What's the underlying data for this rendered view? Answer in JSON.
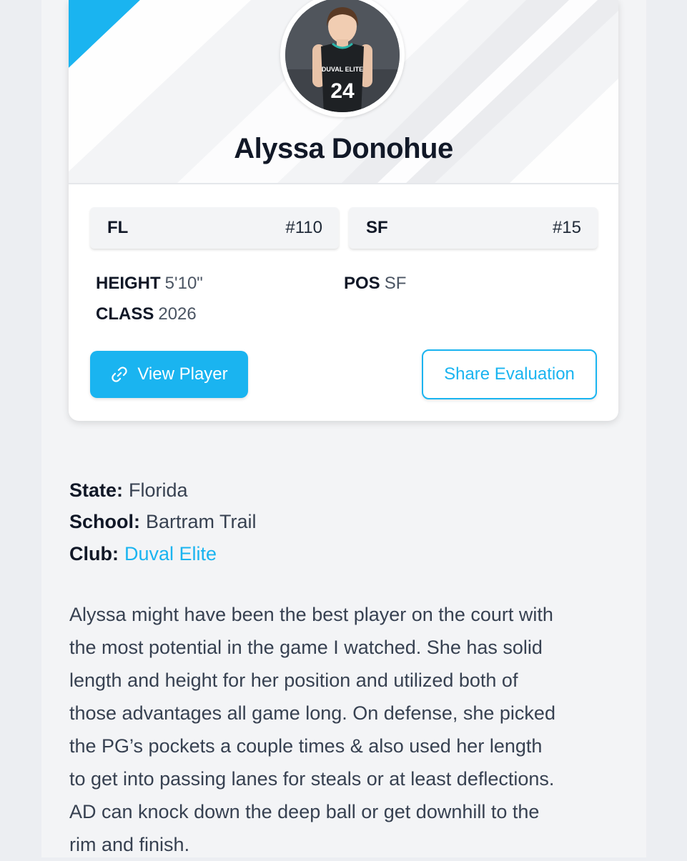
{
  "player": {
    "name": "Alyssa Donohue",
    "jersey_text": "DUVAL ELITE",
    "jersey_number": "24"
  },
  "rankings": [
    {
      "label": "FL",
      "value": "#110"
    },
    {
      "label": "SF",
      "value": "#15"
    }
  ],
  "attributes": {
    "height_label": "HEIGHT",
    "height_value": "5'10\"",
    "class_label": "CLASS",
    "class_value": "2026",
    "pos_label": "POS",
    "pos_value": "SF"
  },
  "buttons": {
    "view_player": "View Player",
    "share_evaluation": "Share Evaluation"
  },
  "details": {
    "state_label": "State:",
    "state_value": "Florida",
    "school_label": "School:",
    "school_value": "Bartram Trail",
    "club_label": "Club:",
    "club_value": "Duval Elite"
  },
  "description_lines": [
    "Alyssa might have been the best player on the court with",
    "the most potential in the game I watched. She has solid",
    "length and height for her position and utilized both of",
    "those advantages all game long. On defense, she picked",
    "the PG’s pockets a couple times & also used her length",
    "to get into passing lanes for steals or at least deflections.",
    "AD can knock down the deep ball or get downhill to the",
    "rim and finish."
  ],
  "colors": {
    "accent": "#1ab4f0",
    "jersey_accent": "#2bb3a8"
  }
}
